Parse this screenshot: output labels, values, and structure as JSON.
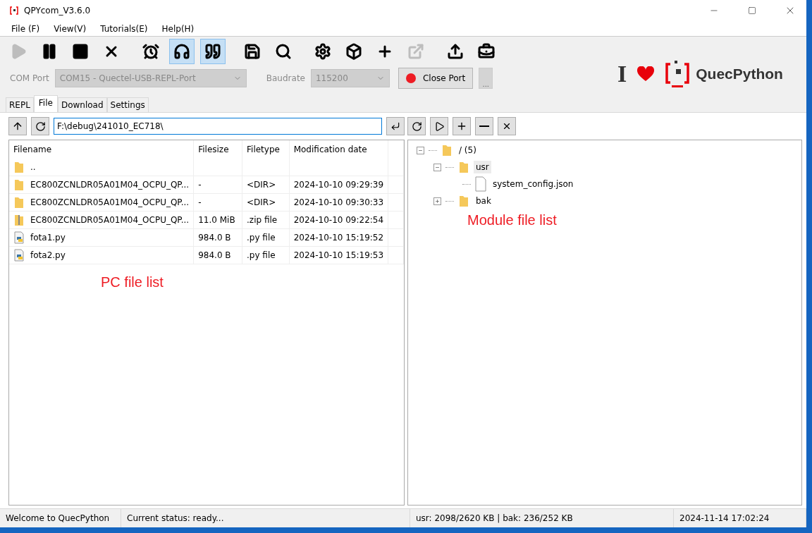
{
  "window": {
    "title": "QPYcom_V3.6.0"
  },
  "menu": [
    "File (F)",
    "View(V)",
    "Tutorials(E)",
    "Help(H)"
  ],
  "toolbar": [
    {
      "kind": "play",
      "disabled": true,
      "selected": false
    },
    {
      "kind": "pause",
      "disabled": false,
      "selected": false
    },
    {
      "kind": "stop",
      "disabled": false,
      "selected": false
    },
    {
      "kind": "clear",
      "disabled": false,
      "selected": false
    },
    {
      "kind": "alarm",
      "disabled": false,
      "selected": false
    },
    {
      "kind": "headset",
      "disabled": false,
      "selected": true
    },
    {
      "kind": "quote",
      "disabled": false,
      "selected": true
    },
    {
      "kind": "save",
      "disabled": false,
      "selected": false
    },
    {
      "kind": "search",
      "disabled": false,
      "selected": false
    },
    {
      "kind": "settings",
      "disabled": false,
      "selected": false
    },
    {
      "kind": "box",
      "disabled": false,
      "selected": false
    },
    {
      "kind": "plus",
      "disabled": false,
      "selected": false
    },
    {
      "kind": "export",
      "disabled": true,
      "selected": false
    },
    {
      "kind": "upload",
      "disabled": false,
      "selected": false
    },
    {
      "kind": "toolbox",
      "disabled": false,
      "selected": false
    }
  ],
  "port": {
    "com_label": "COM Port",
    "com_value": "COM15 - Quectel-USB-REPL-Port",
    "baud_label": "Baudrate",
    "baud_value": "115200",
    "close_button": "Close Port",
    "more_button": "..."
  },
  "logo": {
    "letter": "I",
    "brand": "QuecPython"
  },
  "tabs": [
    {
      "label": "REPL",
      "selected": false
    },
    {
      "label": "File",
      "selected": true
    },
    {
      "label": "Download",
      "selected": false
    },
    {
      "label": "Settings",
      "selected": false
    }
  ],
  "pc": {
    "path": "F:\\debug\\241010_EC718\\",
    "columns": [
      "Filename",
      "Filesize",
      "Filetype",
      "Modification date"
    ],
    "rows": [
      {
        "kind": "folder",
        "name": "..",
        "size": "",
        "type": "",
        "date": ""
      },
      {
        "kind": "folder",
        "name": "EC800ZCNLDR05A01M04_OCPU_QP...",
        "size": "-",
        "type": "<DIR>",
        "date": "2024-10-10 09:29:39"
      },
      {
        "kind": "folder",
        "name": "EC800ZCNLDR05A01M04_OCPU_QP...",
        "size": "-",
        "type": "<DIR>",
        "date": "2024-10-10 09:30:33"
      },
      {
        "kind": "zip",
        "name": "EC800ZCNLDR05A01M04_OCPU_QP...",
        "size": "11.0 MiB",
        "type": ".zip file",
        "date": "2024-10-10 09:22:54"
      },
      {
        "kind": "py",
        "name": "fota1.py",
        "size": "984.0 B",
        "type": ".py file",
        "date": "2024-10-10 15:19:52"
      },
      {
        "kind": "py",
        "name": "fota2.py",
        "size": "984.0 B",
        "type": ".py file",
        "date": "2024-10-10 15:19:53"
      }
    ],
    "annotation": "PC file list"
  },
  "module": {
    "tree": [
      {
        "kind": "folder",
        "label": "/ (5)",
        "expanded": true,
        "selected": false,
        "children": [
          {
            "kind": "folder",
            "label": "usr",
            "expanded": true,
            "selected": true,
            "children": [
              {
                "kind": "file",
                "label": "system_config.json",
                "selected": false
              }
            ]
          },
          {
            "kind": "folder",
            "label": "bak",
            "expanded": false,
            "selected": false
          }
        ]
      }
    ],
    "annotation": "Module file list"
  },
  "status_bar": [
    "Welcome to QuecPython",
    "Current status: ready...",
    "usr: 2098/2620 KB | bak: 236/252 KB",
    "2024-11-14 17:02:24"
  ]
}
